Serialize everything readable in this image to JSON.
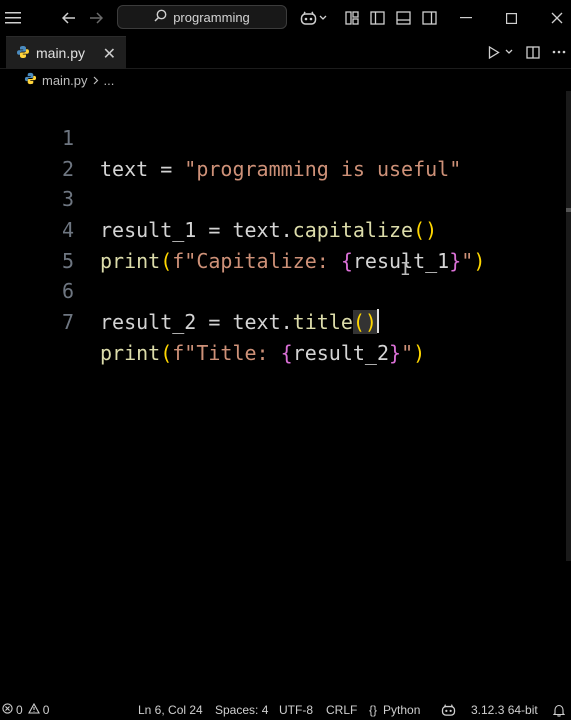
{
  "search": {
    "text": "programming"
  },
  "tab": {
    "filename": "main.py",
    "close_glyph": "✕"
  },
  "breadcrumb": {
    "file": "main.py",
    "ellipsis": "..."
  },
  "editor": {
    "lines": [
      {
        "num": "1"
      },
      {
        "num": "2"
      },
      {
        "num": "3"
      },
      {
        "num": "4"
      },
      {
        "num": "5"
      },
      {
        "num": "6"
      },
      {
        "num": "7"
      }
    ],
    "code": {
      "l1_var": "text",
      "l1_eq": " = ",
      "l1_str": "\"programming is useful\"",
      "l3_var": "result_1",
      "l3_eq": " = text.",
      "l3_fn": "capitalize",
      "l3_paren": "()",
      "l4_fn": "print",
      "l4_open": "(",
      "l4_str1": "f\"Capitalize: ",
      "l4_brace_open": "{",
      "l4_var": "result_1",
      "l4_brace_close": "}",
      "l4_str2": "\"",
      "l4_close": ")",
      "l6_var": "result_2",
      "l6_eq": " = text.",
      "l6_fn": "title",
      "l6_paren": "()",
      "l7_fn": "print",
      "l7_open": "(",
      "l7_str1": "f\"Title: ",
      "l7_brace_open": "{",
      "l7_var": "result_2",
      "l7_brace_close": "}",
      "l7_str2": "\"",
      "l7_close": ")"
    }
  },
  "status": {
    "errors": "0",
    "warnings": "0",
    "position": "Ln 6, Col 24",
    "spaces": "Spaces: 4",
    "encoding": "UTF-8",
    "eol": "CRLF",
    "language_braces": "{}",
    "language": "Python",
    "interpreter": "3.12.3 64-bit"
  },
  "colors": {
    "string": "#ce9178",
    "function": "#dcdcaa",
    "bracket": "#ffd700",
    "brace": "#da70d6"
  }
}
